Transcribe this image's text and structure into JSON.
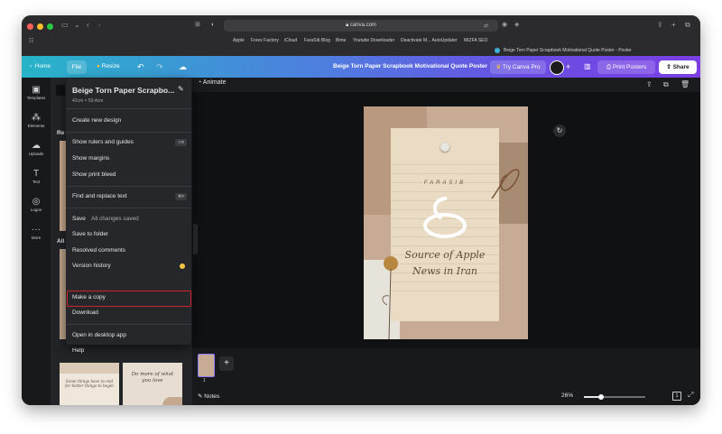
{
  "browser": {
    "url": "canva.com",
    "favorites": [
      "Apple",
      "Forex Factory",
      "iCloud",
      "FaraSib Blog",
      "Bime",
      "Youtube Downloader",
      "Deactivate M... AutoUpdater",
      "MIZFA SEO"
    ],
    "tab_title": "Beige Torn Paper Scrapbook Motivational Quote Poster - Poster"
  },
  "header": {
    "home": "Home",
    "file": "File",
    "resize": "Resize",
    "doc_title": "Beige Torn Paper Scrapbook Motivational Quote Poster",
    "try_pro": "Try Canva Pro",
    "print": "Print Posters",
    "share": "Share",
    "accent_start": "#27b4c8",
    "accent_end": "#7b3fe4"
  },
  "rail": {
    "items": [
      {
        "label": "Templates",
        "icon": "templates-icon"
      },
      {
        "label": "Elements",
        "icon": "elements-icon"
      },
      {
        "label": "Uploads",
        "icon": "uploads-icon"
      },
      {
        "label": "Text",
        "icon": "text-icon"
      },
      {
        "label": "Logos",
        "icon": "logos-icon"
      },
      {
        "label": "More",
        "icon": "more-icon"
      }
    ]
  },
  "panel": {
    "section_re": "Re",
    "section_all": "All",
    "thumb1_text": "Some things have to end for better things to begin",
    "thumb2_text": "Do more of what you love"
  },
  "menu": {
    "title": "Beige Torn Paper Scrapbo...",
    "subtitle": "42cm × 59.4cm",
    "items": {
      "create_new": "Create new design",
      "rulers": "Show rulers and guides",
      "rulers_kbd": "⇧R",
      "margins": "Show margins",
      "bleed": "Show print bleed",
      "find_replace": "Find and replace text",
      "find_kbd": "⌘F",
      "save": "Save",
      "save_status": "All changes saved",
      "save_folder": "Save to folder",
      "resolved": "Resolved comments",
      "version_history": "Version history",
      "make_copy": "Make a copy",
      "download": "Download",
      "desktop_app": "Open in desktop app",
      "help": "Help"
    }
  },
  "toolbar": {
    "animate": "Animate"
  },
  "poster": {
    "brand": "FARASIB",
    "quote_line1": "Source of Apple",
    "quote_line2": "News in Iran"
  },
  "pages": {
    "page_number": "1"
  },
  "footer": {
    "notes": "Notes",
    "zoom": "26%",
    "page_count": "1",
    "zoom_fraction": 0.28
  }
}
